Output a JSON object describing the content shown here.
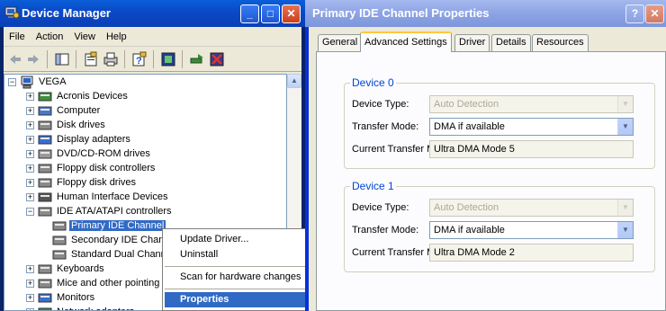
{
  "device_manager": {
    "title": "Device Manager",
    "caption_buttons": {
      "minimize": "_",
      "maximize": "□",
      "close": "✕"
    },
    "menu": [
      "File",
      "Action",
      "View",
      "Help"
    ],
    "toolbar_icons": [
      "back-icon",
      "forward-icon",
      "show-hide-tree-icon",
      "properties-icon",
      "print-icon",
      "help-icon",
      "scan-hardware-icon",
      "update-driver-icon",
      "uninstall-icon"
    ],
    "tree": {
      "root": "VEGA",
      "items": [
        {
          "label": "Acronis Devices",
          "exp": "+",
          "level": 1
        },
        {
          "label": "Computer",
          "exp": "+",
          "level": 1
        },
        {
          "label": "Disk drives",
          "exp": "+",
          "level": 1
        },
        {
          "label": "Display adapters",
          "exp": "+",
          "level": 1
        },
        {
          "label": "DVD/CD-ROM drives",
          "exp": "+",
          "level": 1
        },
        {
          "label": "Floppy disk controllers",
          "exp": "+",
          "level": 1
        },
        {
          "label": "Floppy disk drives",
          "exp": "+",
          "level": 1
        },
        {
          "label": "Human Interface Devices",
          "exp": "+",
          "level": 1
        },
        {
          "label": "IDE ATA/ATAPI controllers",
          "exp": "−",
          "level": 1
        },
        {
          "label": "Primary IDE Channel",
          "exp": "",
          "level": 2,
          "selected": true
        },
        {
          "label": "Secondary IDE Chann",
          "exp": "",
          "level": 2
        },
        {
          "label": "Standard Dual Chann",
          "exp": "",
          "level": 2
        },
        {
          "label": "Keyboards",
          "exp": "+",
          "level": 1
        },
        {
          "label": "Mice and other pointing d",
          "exp": "+",
          "level": 1
        },
        {
          "label": "Monitors",
          "exp": "+",
          "level": 1
        },
        {
          "label": "Network adapters",
          "exp": "+",
          "level": 1
        }
      ]
    },
    "context_menu": {
      "update_driver": "Update Driver...",
      "uninstall": "Uninstall",
      "scan": "Scan for hardware changes",
      "properties": "Properties"
    }
  },
  "properties_dialog": {
    "title": "Primary IDE Channel Properties",
    "caption_buttons": {
      "help": "?",
      "close": "✕"
    },
    "tabs": [
      "General",
      "Advanced Settings",
      "Driver",
      "Details",
      "Resources"
    ],
    "active_tab": "Advanced Settings",
    "devices": [
      {
        "group_title": "Device 0",
        "device_type_label": "Device Type:",
        "device_type_value": "Auto Detection",
        "transfer_mode_label": "Transfer Mode:",
        "transfer_mode_value": "DMA if available",
        "current_mode_label": "Current Transfer Mode:",
        "current_mode_value": "Ultra DMA Mode 5"
      },
      {
        "group_title": "Device 1",
        "device_type_label": "Device Type:",
        "device_type_value": "Auto Detection",
        "transfer_mode_label": "Transfer Mode:",
        "transfer_mode_value": "DMA if available",
        "current_mode_label": "Current Transfer Mode:",
        "current_mode_value": "Ultra DMA Mode 2"
      }
    ]
  },
  "colors": {
    "xp_blue_title": "#0b49c8",
    "inactive_title": "#8da4e4",
    "selection": "#316ac5",
    "group_title": "#0046d5"
  }
}
